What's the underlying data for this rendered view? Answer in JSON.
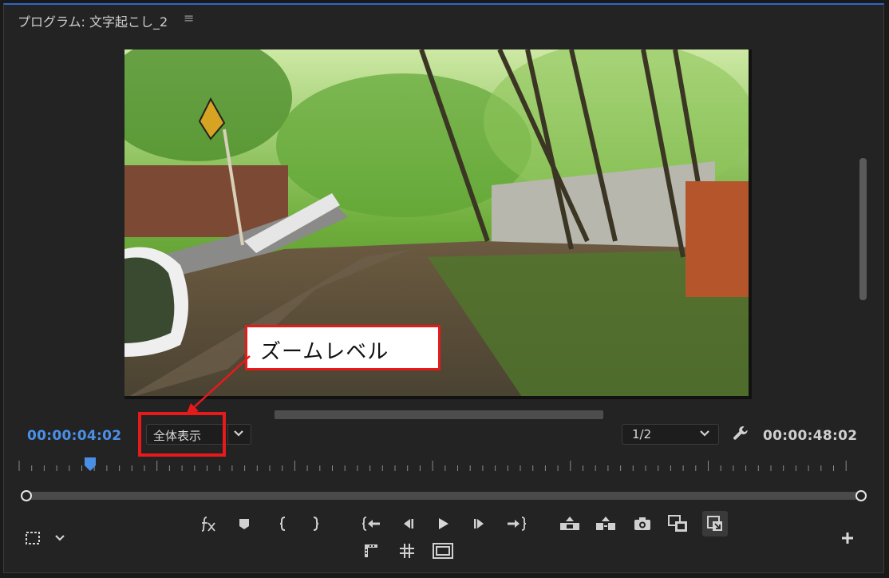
{
  "panel": {
    "title": "プログラム: 文字起こし_2",
    "menu_icon": "≡"
  },
  "timecode": {
    "current": "00:00:04:02",
    "duration": "00:00:48:02"
  },
  "zoom": {
    "label": "全体表示"
  },
  "resolution": {
    "label": "1/2"
  },
  "annotation": {
    "label": "ズームレベル",
    "accent_color": "#e8191a"
  },
  "colors": {
    "timecode_current": "#4a90e8",
    "panel_border_active": "#2f67c9"
  },
  "playback": {
    "playhead_fraction": 0.085,
    "scrollbar_vertical": "present",
    "scrollbar_horizontal": "present"
  },
  "icons": {
    "toolbar_row1": [
      "fx-icon",
      "marker-icon",
      "mark-in-icon",
      "mark-out-icon",
      "go-to-in-icon",
      "step-back-icon",
      "play-icon",
      "step-forward-icon",
      "go-to-out-icon",
      "lift-icon",
      "extract-icon",
      "export-frame-icon",
      "insert-icon",
      "overwrite-icon"
    ],
    "toolbar_row2": [
      "safe-margins-icon",
      "grid-icon",
      "comparison-view-icon"
    ],
    "left": [
      "selection-box-icon",
      "chevron-down-icon"
    ],
    "right": [
      "plus-icon"
    ]
  }
}
